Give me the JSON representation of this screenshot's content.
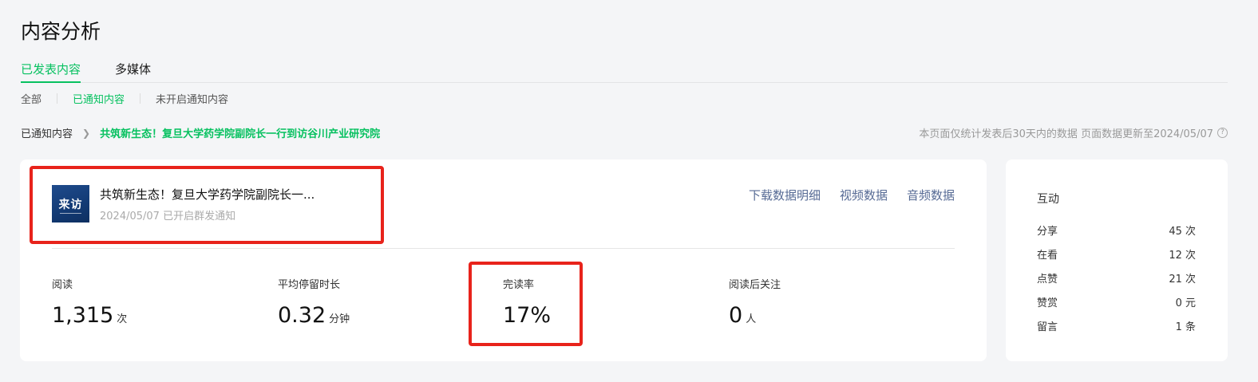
{
  "page": {
    "title": "内容分析"
  },
  "tabs": [
    {
      "label": "已发表内容",
      "active": true
    },
    {
      "label": "多媒体",
      "active": false
    }
  ],
  "subtabs": [
    {
      "label": "全部",
      "active": false
    },
    {
      "label": "已通知内容",
      "active": true
    },
    {
      "label": "未开启通知内容",
      "active": false
    }
  ],
  "breadcrumb": {
    "parent": "已通知内容",
    "current": "共筑新生态！复旦大学药学院副院长一行到访谷川产业研究院"
  },
  "data_note": "本页面仅统计发表后30天内的数据 页面数据更新至2024/05/07",
  "article": {
    "thumb_text": "来访",
    "title": "共筑新生态！复旦大学药学院副院长一...",
    "date": "2024/05/07",
    "status": "已开启群发通知"
  },
  "actions": [
    "下载数据明细",
    "视频数据",
    "音频数据"
  ],
  "metrics": [
    {
      "label": "阅读",
      "value": "1,315",
      "unit": "次"
    },
    {
      "label": "平均停留时长",
      "value": "0.32",
      "unit": "分钟"
    },
    {
      "label": "完读率",
      "value": "17%",
      "unit": ""
    },
    {
      "label": "阅读后关注",
      "value": "0",
      "unit": "人"
    }
  ],
  "interaction": {
    "title": "互动",
    "rows": [
      {
        "label": "分享",
        "value": "45 次"
      },
      {
        "label": "在看",
        "value": "12 次"
      },
      {
        "label": "点赞",
        "value": "21 次"
      },
      {
        "label": "赞赏",
        "value": "0 元"
      },
      {
        "label": "留言",
        "value": "1 条"
      }
    ]
  },
  "colors": {
    "accent": "#07c160",
    "link": "#576b95",
    "highlight": "#e8231b",
    "background": "#f4f5f7"
  }
}
